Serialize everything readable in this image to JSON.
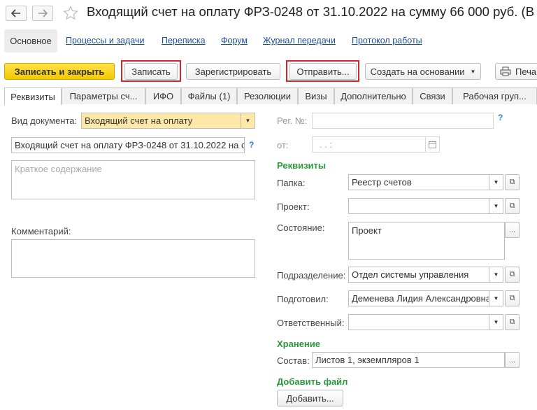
{
  "title": "Входящий счет на оплату ФРЗ-0248 от 31.10.2022 на сумму 66 000 руб. (В",
  "subnav": {
    "active": "Основное",
    "links": [
      "Процессы и задачи",
      "Переписка",
      "Форум",
      "Журнал передачи",
      "Протокол работы"
    ]
  },
  "toolbar": {
    "save_close": "Записать и закрыть",
    "save": "Записать",
    "register": "Зарегистрировать",
    "send": "Отправить...",
    "create_based": "Создать на основании",
    "print": "Печа"
  },
  "tabs": [
    "Реквизиты",
    "Параметры сч...",
    "ИФО",
    "Файлы (1)",
    "Резолюции",
    "Визы",
    "Дополнительно",
    "Связи",
    "Рабочая груп..."
  ],
  "form": {
    "doc_type_label": "Вид документа:",
    "doc_type_value": "Входящий счет на оплату",
    "doc_name": "Входящий счет на оплату ФРЗ-0248 от 31.10.2022 на сумму",
    "summary_placeholder": "Краткое содержание",
    "comment_label": "Комментарий:",
    "reg_no_label": "Рег. №:",
    "from_label": "от:",
    "date_placeholder": ".  .     :",
    "help": "?",
    "requisites_section": "Реквизиты",
    "folder_label": "Папка:",
    "folder_value": "Реестр счетов",
    "project_label": "Проект:",
    "state_label": "Состояние:",
    "state_value": "Проект",
    "department_label": "Подразделение:",
    "department_value": "Отдел системы управления",
    "prepared_label": "Подготовил:",
    "prepared_value": "Деменева Лидия Александровна",
    "responsible_label": "Ответственный:",
    "storage_section": "Хранение",
    "composition_label": "Состав:",
    "composition_value": "Листов 1, экземпляров 1",
    "add_file_section": "Добавить файл",
    "add_button": "Добавить...",
    "ellipsis": "..."
  }
}
